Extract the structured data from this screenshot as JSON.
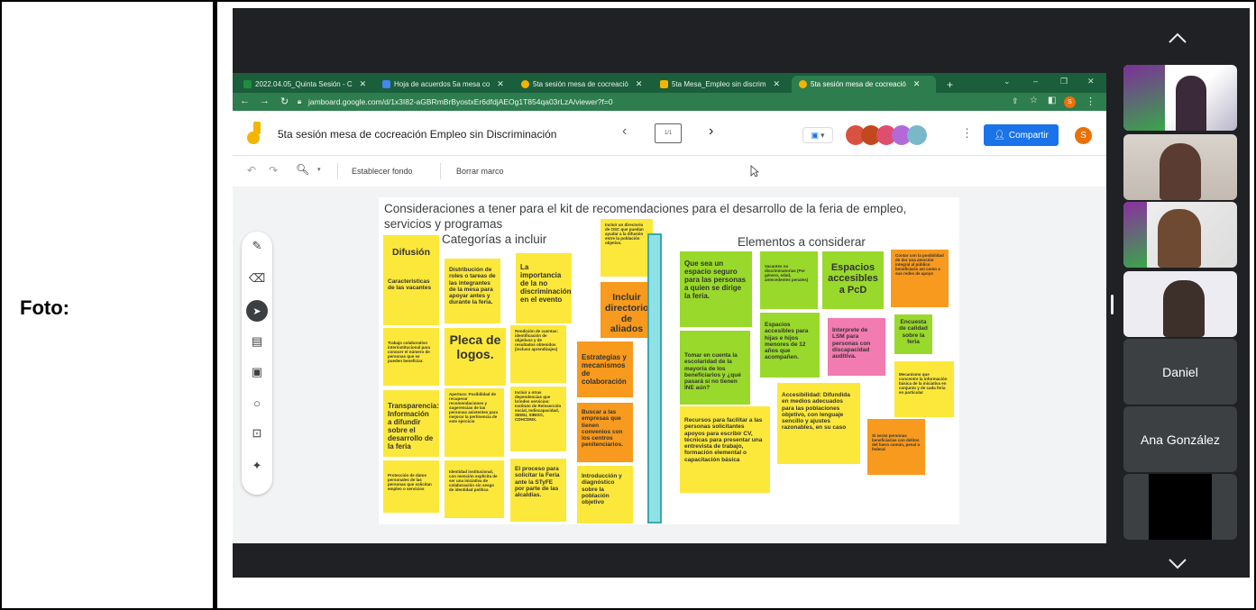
{
  "document": {
    "label": "Foto:"
  },
  "browser": {
    "tabs": [
      {
        "label": "2022.04.05_Quinta Sesión - C",
        "color": "#1e8e3e"
      },
      {
        "label": "Hoja de acuerdos 5a mesa co",
        "color": "#4285f4"
      },
      {
        "label": "5ta sesión mesa de cocreació",
        "color": "#f4b400"
      },
      {
        "label": "5ta Mesa_Empleo sin discrim",
        "color": "#f4b400"
      },
      {
        "label": "5ta sesión mesa de cocreació",
        "color": "#f4b400"
      }
    ],
    "new_tab": "+",
    "url": "jamboard.google.com/d/1x3I82-aGBRmBrByostxEr6dfdjAEOg1T854qa03rLzA/viewer?f=0"
  },
  "jamboard": {
    "doc_title": "5ta sesión mesa de cocreación Empleo sin Discriminación",
    "frame_counter": "1/1",
    "share_label": "Compartir",
    "user_initial": "S",
    "toolbar": {
      "set_background": "Establecer fondo",
      "clear_frame": "Borrar marco"
    },
    "board": {
      "title": "Consideraciones a tener para el kit de recomendaciones para el desarrollo de la feria de empleo, servicios y programas",
      "left_heading": "Categorías a incluir",
      "right_heading": "Elementos a considerar",
      "notes": {
        "n01": "Difusión",
        "n02": "Caracteristicas de las vacantes",
        "n03": "Distribución de roles o tareas de las integrantes de la mesa para apoyar antes y durante la feria.",
        "n04": "La importancia de la no discriminación en el evento",
        "n05": "Incluir un directorio de OSC que puedan ayudar a la difusión entre la población objetivo.",
        "n06": "Incluir directorio de aliados",
        "n07": "Trabajo colaborativo interinstitucional para conocer el número de personas que se pueden beneficiar.",
        "n08": "Pleca de logos.",
        "n09": "Rendición de cuentas: identificación de objetivos y de resultados obtenidos (incluso aprendizajes)",
        "n10": "Estrategias y mecanismos de colaboración",
        "n11": "Transparencia: Información a difundir sobre el desarrollo de la feria",
        "n12": "Apertura: Posibilidad de recuperar recomendaciones y sugerencias de las personas asistentes para mejorar la pertinencia de este ejercicio",
        "n13": "Incluir a otras dependencias que brinden servicios: Instituto de Reinserción social, Indiscapacidad, SEMU, SIBISO, CDHCDMX.",
        "n14": "Buscar a las empresas que tienen convenios con los centros penitenciarios.",
        "n15": "Protección de datos personales de las personas que solicitan empleo o servicios",
        "n16": "Identidad institucional, con mención explícita de ser una iniciativa de colaboración sin sesgo de identidad política",
        "n17": "El proceso para solicitar la Feria ante la STyFE por parte de las alcaldías.",
        "n18": "Introducción y diagnóstico sobre la población objetivo",
        "e01": "Que sea un espacio seguro para las personas a quien se dirige la feria.",
        "e02": "Vacantes no discriminatorias (Por género, edad, antecedentes penales)",
        "e03": "Espacios accesibles a PcD",
        "e04": "Contar con la posibilidad de dar una atención integral al público beneficiario así como a sus redes de apoyo",
        "e05": "Tomar en cuenta la escolaridad de la mayoría de los beneficiarios y ¿qué pasará si no tienen INE aún?",
        "e06": "Espacios accesibles para hijas e hijos menores de 12 años que acompañen.",
        "e07": "Interprete de LSM para personas con discapacidad auditiva.",
        "e08": "Encuesta de calidad sobre la feria",
        "e09": "Mecanismo que concentre la información básica de la iniciativa en conjunto y de cada feria en particular",
        "e10": "Accesibilidad: Difundida en medios adecuados para las poblaciones objetivo, con lenguaje sencillo y ajustes razonables, en su caso",
        "e11": "Recursos para facilitar a las personas solicitantes apoyos para escribir CV, técnicas para presentar una entrevista de trabajo, formación elemental o capacitación básica",
        "e12": "Si serán personas beneficiarias con delitos del fuero común, penal o federal"
      }
    }
  },
  "participants": {
    "tile5": "Daniel",
    "tile6": "Ana González"
  }
}
